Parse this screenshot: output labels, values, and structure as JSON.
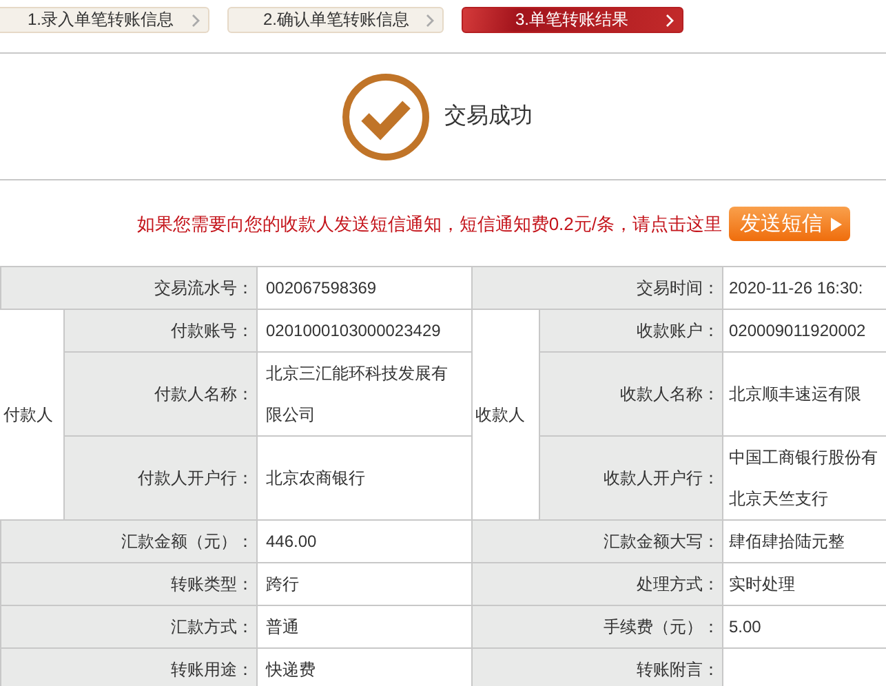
{
  "steps": [
    {
      "label": "1.录入单笔转账信息",
      "selected": false
    },
    {
      "label": "2.确认单笔转账信息",
      "selected": false
    },
    {
      "label": "3.单笔转账结果",
      "selected": true
    }
  ],
  "result": {
    "text": "交易成功"
  },
  "sms": {
    "notice": "如果您需要向您的收款人发送短信通知，短信通知费0.2元/条，请点击这里",
    "button": "发送短信"
  },
  "details": {
    "top": [
      {
        "label": "交易流水号：",
        "value": "002067598369"
      },
      {
        "label": "交易时间：",
        "value": "2020-11-26 16:30:"
      }
    ],
    "payer": {
      "title": "付款人",
      "fields": [
        {
          "label": "付款账号：",
          "lines": [
            "0201000103000023429"
          ]
        },
        {
          "label": "付款人名称：",
          "lines": [
            "北京三汇能环科技发展有限公司"
          ]
        },
        {
          "label": "付款人开户行：",
          "lines": [
            "北京农商银行"
          ]
        }
      ]
    },
    "payee": {
      "title": "收款人",
      "fields": [
        {
          "label": "收款账户：",
          "lines": [
            "020009011920002"
          ]
        },
        {
          "label": "收款人名称：",
          "lines": [
            "北京顺丰速运有限"
          ]
        },
        {
          "label": "收款人开户行：",
          "lines": [
            "中国工商银行股份有",
            "北京天竺支行"
          ]
        }
      ]
    },
    "rows": [
      [
        {
          "label": "汇款金额（元）：",
          "value": "446.00"
        },
        {
          "label": "汇款金额大写：",
          "value": "肆佰肆拾陆元整"
        }
      ],
      [
        {
          "label": "转账类型：",
          "value": "跨行"
        },
        {
          "label": "处理方式：",
          "value": "实时处理"
        }
      ],
      [
        {
          "label": "汇款方式：",
          "value": "普通"
        },
        {
          "label": "手续费（元）：",
          "value": "5.00"
        }
      ],
      [
        {
          "label": "转账用途：",
          "value": "快递费"
        },
        {
          "label": "转账附言："
        }
      ]
    ]
  }
}
